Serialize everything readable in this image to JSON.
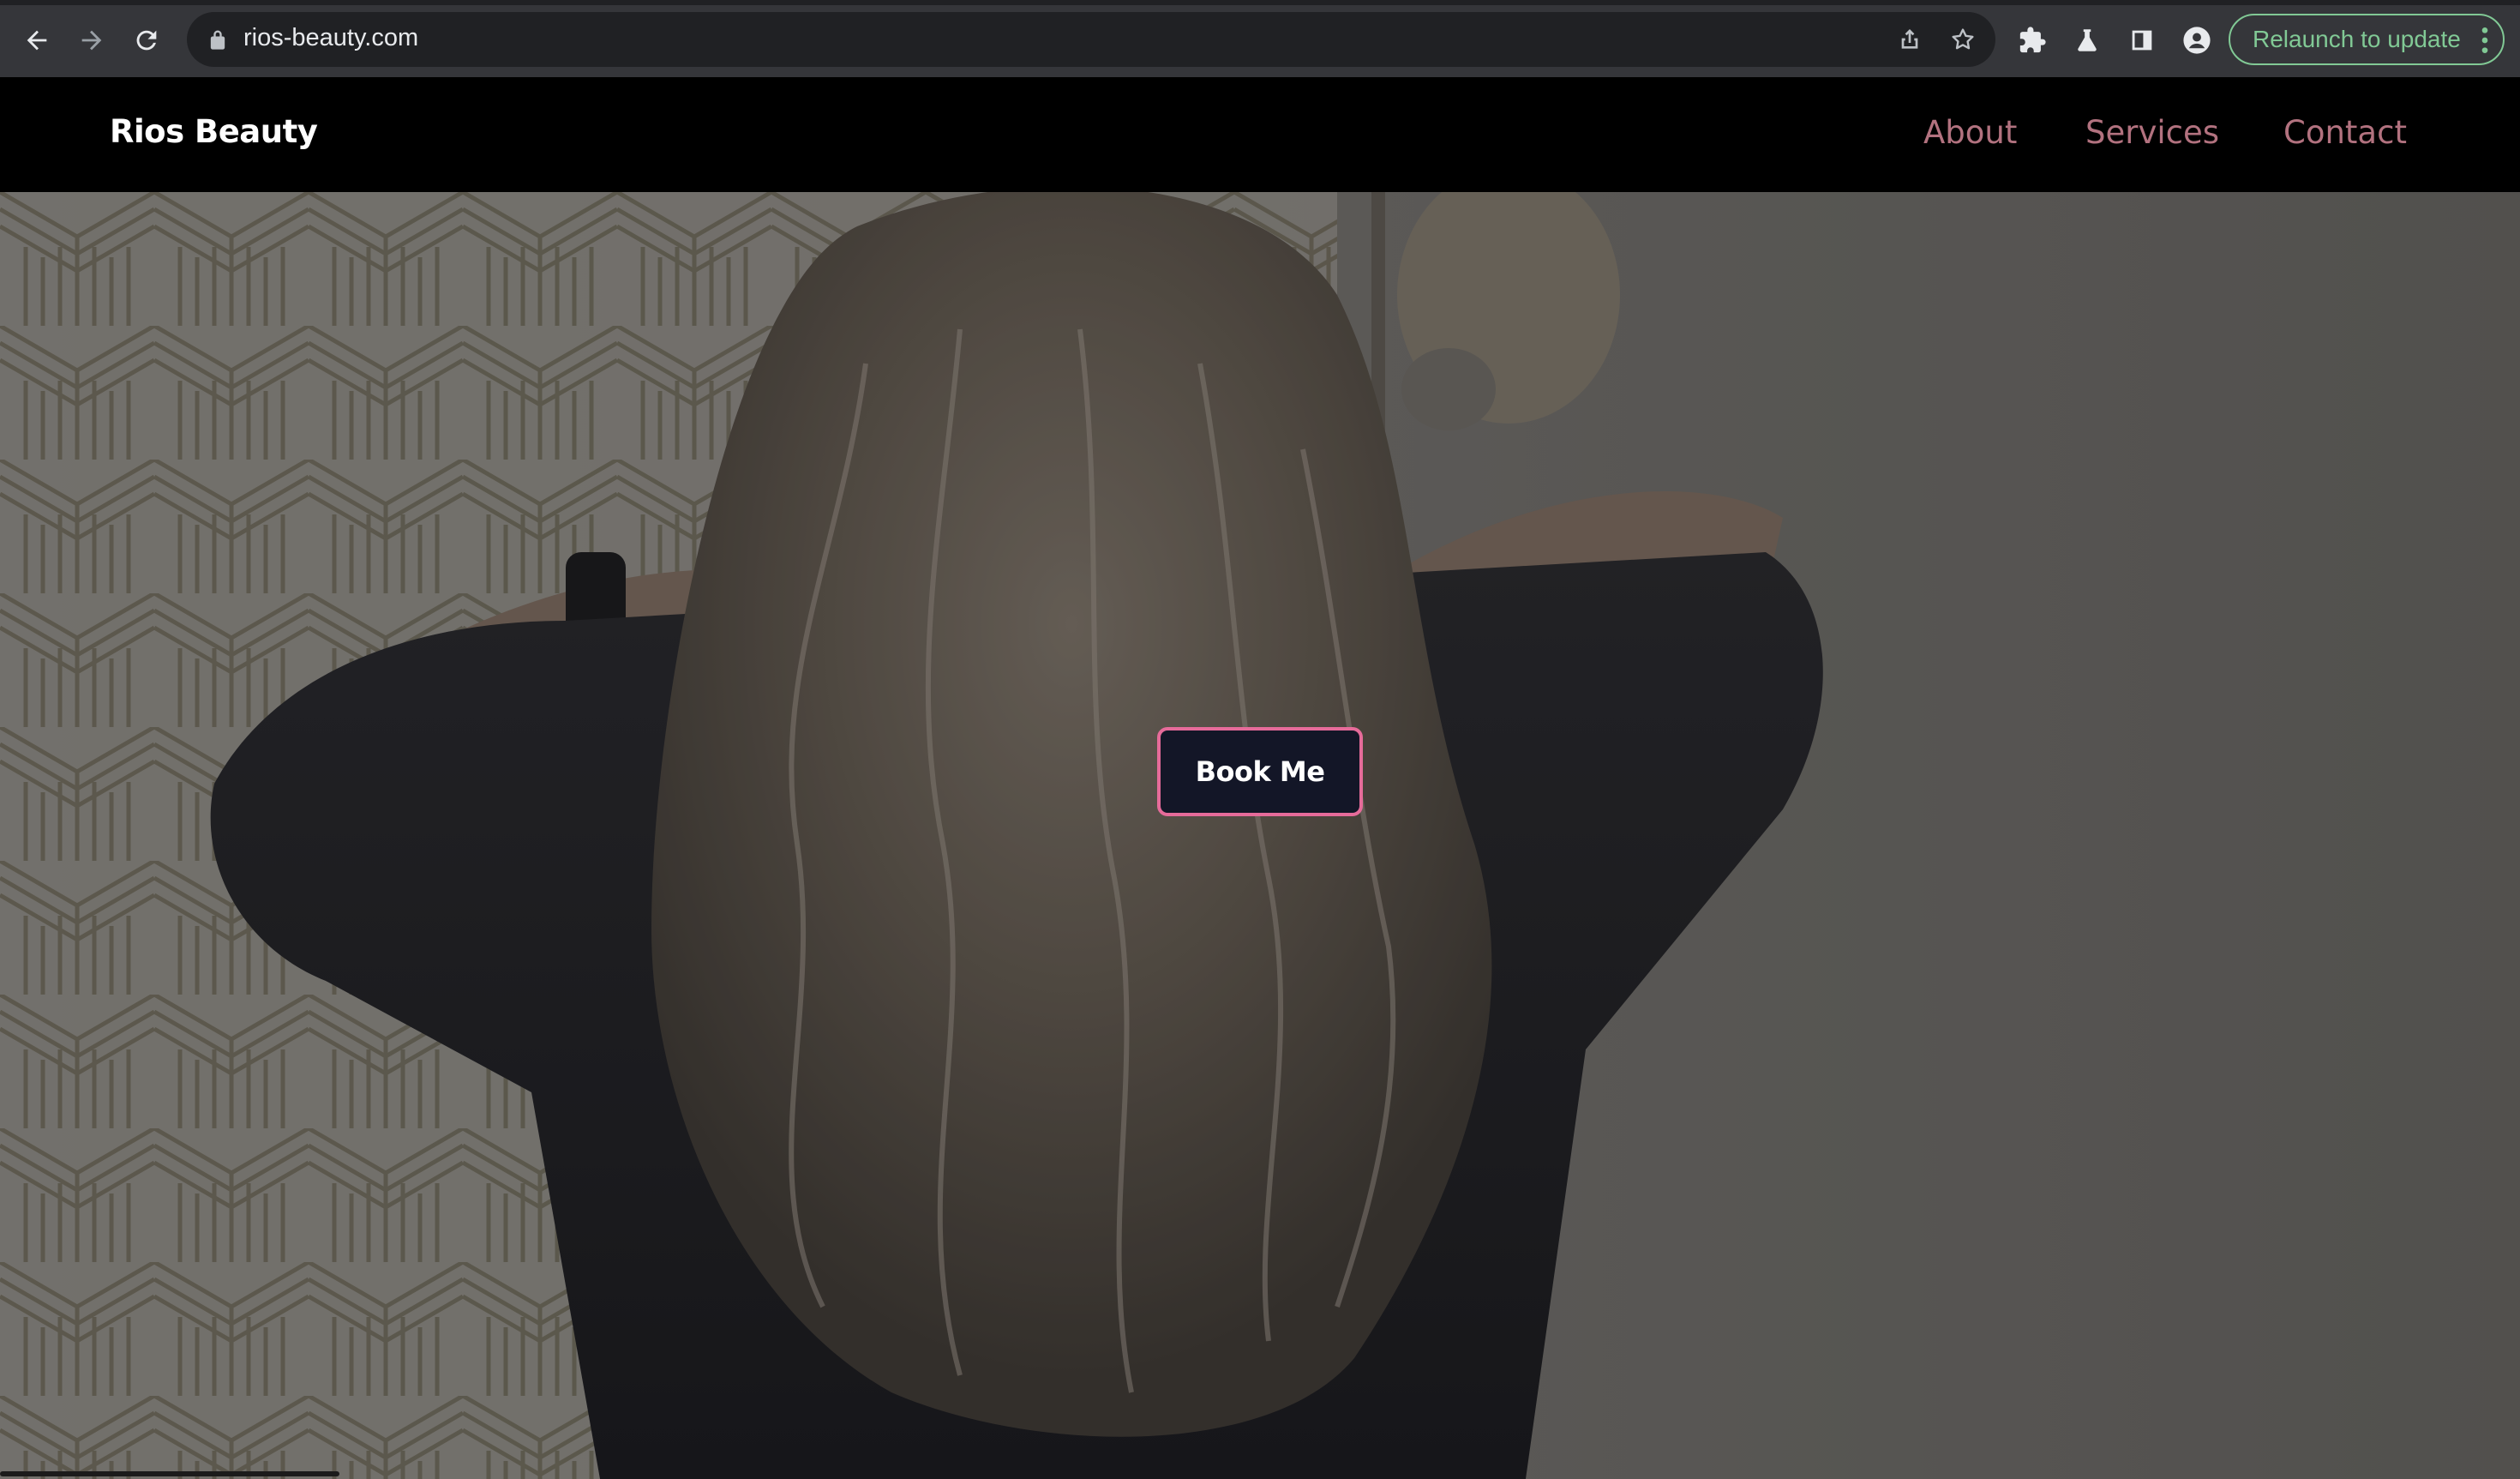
{
  "browser": {
    "url": "rios-beauty.com",
    "relaunch_label": "Relaunch to update",
    "icons": [
      "back-icon",
      "forward-icon",
      "reload-icon",
      "lock-icon",
      "share-icon",
      "bookmark-star-icon",
      "extensions-puzzle-icon",
      "labs-flask-icon",
      "side-panel-icon",
      "profile-icon",
      "more-vert-icon"
    ],
    "accent_color": "#81c995"
  },
  "site": {
    "brand": "Rios Beauty",
    "nav": {
      "about": "About",
      "services": "Services",
      "contact": "Contact"
    },
    "nav_color": "#b2727f",
    "hero": {
      "cta_label": "Book Me",
      "cta_border_color": "#e66b9a",
      "cta_bg_color": "#131627"
    }
  }
}
